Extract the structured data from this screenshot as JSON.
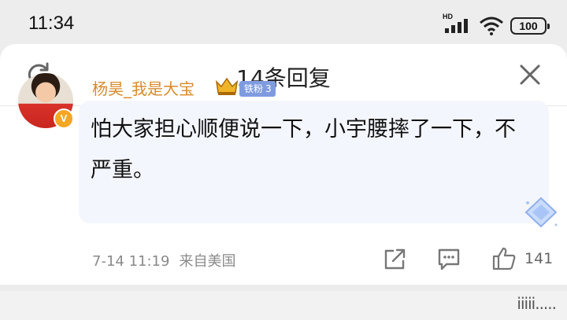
{
  "status_bar": {
    "time": "11:34",
    "network_label": "HD",
    "battery": "100",
    "icons": [
      "signal-icon",
      "wifi-icon",
      "battery-icon"
    ]
  },
  "header": {
    "title": "14条回复",
    "left_icon": "refresh-icon",
    "right_icon": "close-icon"
  },
  "comment": {
    "author": "杨昊_我是大宝",
    "verified_mark": "V",
    "fan_badge": "铁粉",
    "fan_level": "3",
    "text": "怕大家担心顺便说一下，小宇腰摔了一下，不严重。",
    "time": "7-14 11:19",
    "source": "来自美国",
    "likes": "141"
  },
  "watermark": "iiiii.....",
  "colors": {
    "username": "#d98a2b",
    "fan_badge": "#7f9be0",
    "bubble": "#f4f6fd",
    "verified": "#f5a623"
  }
}
